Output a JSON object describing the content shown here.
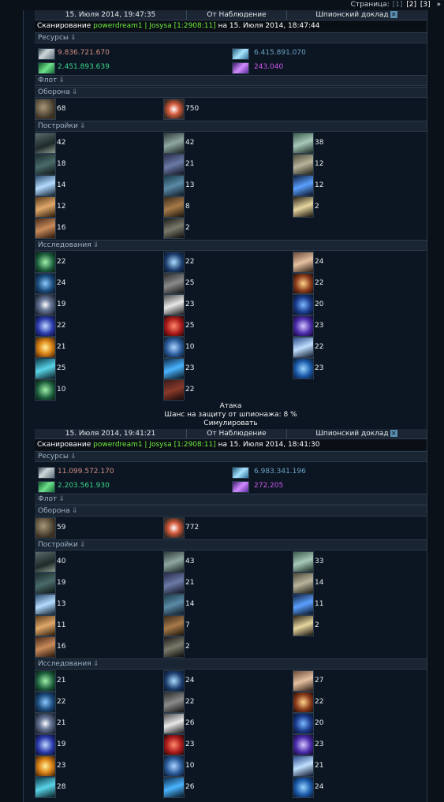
{
  "pager": {
    "label": "Страница:",
    "pages": [
      "[1]",
      "[2]",
      "[3]"
    ],
    "next": "»"
  },
  "reports": [
    {
      "header": {
        "date": "15. Июля 2014, 19:47:35",
        "from": "От Наблюдение",
        "type": "Шпионский доклад"
      },
      "scan": {
        "prefix": "Сканирование",
        "player": "powerdream1 | Josysa [1:2908:11]",
        "suffix": "на 15. Июля 2014, 18:47:44"
      },
      "sections": {
        "resources": "Ресурсы",
        "fleet": "Флот",
        "defense": "Оборона",
        "buildings": "Постройки",
        "research": "Исследования"
      },
      "resources": {
        "metal": "9.836.721.670",
        "crystal": "6.415.891.070",
        "deuterium": "2.451.893.639",
        "energy": "243.040"
      },
      "defense": [
        "68",
        "750"
      ],
      "buildings": [
        "42",
        "42",
        "38",
        "18",
        "21",
        "12",
        "14",
        "13",
        "12",
        "12",
        "8",
        "2",
        "16",
        "2"
      ],
      "research": [
        "22",
        "22",
        "24",
        "24",
        "25",
        "22",
        "19",
        "23",
        "20",
        "22",
        "25",
        "23",
        "21",
        "10",
        "22",
        "25",
        "23",
        "23",
        "10",
        "22"
      ],
      "footer": {
        "attack": "Атака",
        "chance": "Шанс на защиту от шпионажа: 8 %",
        "simulate": "Симулировать"
      }
    },
    {
      "header": {
        "date": "15. Июля 2014, 19:41:21",
        "from": "От Наблюдение",
        "type": "Шпионский доклад"
      },
      "scan": {
        "prefix": "Сканирование",
        "player": "powerdream1 | Josysa [1:2908:11]",
        "suffix": "на 15. Июля 2014, 18:41:30"
      },
      "sections": {
        "resources": "Ресурсы",
        "fleet": "Флот",
        "defense": "Оборона",
        "buildings": "Постройки",
        "research": "Исследования"
      },
      "resources": {
        "metal": "11.099.572.170",
        "crystal": "6.983.341.196",
        "deuterium": "2.203.561.930",
        "energy": "272.205"
      },
      "defense": [
        "59",
        "772"
      ],
      "buildings": [
        "40",
        "43",
        "33",
        "19",
        "21",
        "14",
        "13",
        "14",
        "11",
        "11",
        "7",
        "2",
        "16",
        "2"
      ],
      "research": [
        "21",
        "24",
        "27",
        "22",
        "22",
        "22",
        "21",
        "26",
        "20",
        "19",
        "23",
        "23",
        "23",
        "10",
        "21",
        "28",
        "26",
        "24"
      ],
      "footer": {}
    }
  ],
  "icons": {
    "resources": [
      "metal-icon",
      "crystal-icon",
      "deuterium-icon",
      "energy-icon"
    ],
    "defense": [
      "defense-icon",
      "defense-icon"
    ],
    "buildings": [
      "b1",
      "b2",
      "b3",
      "b4",
      "b5",
      "b6",
      "b7",
      "b8",
      "b9",
      "b10",
      "b11",
      "b12",
      "b13",
      "b14"
    ],
    "research": [
      "r1",
      "r2",
      "r3",
      "r4",
      "r5",
      "r6",
      "r7",
      "r8",
      "r9",
      "r10",
      "r11",
      "r12",
      "r13",
      "r14",
      "r15",
      "r16",
      "r17",
      "r18",
      "r1",
      "r19"
    ]
  },
  "colors": {
    "metal": "#cf8d84",
    "crystal": "#6aa2c4",
    "deuterium": "#3ad48a",
    "energy": "#cc55ee",
    "player": "#6eea3c"
  }
}
